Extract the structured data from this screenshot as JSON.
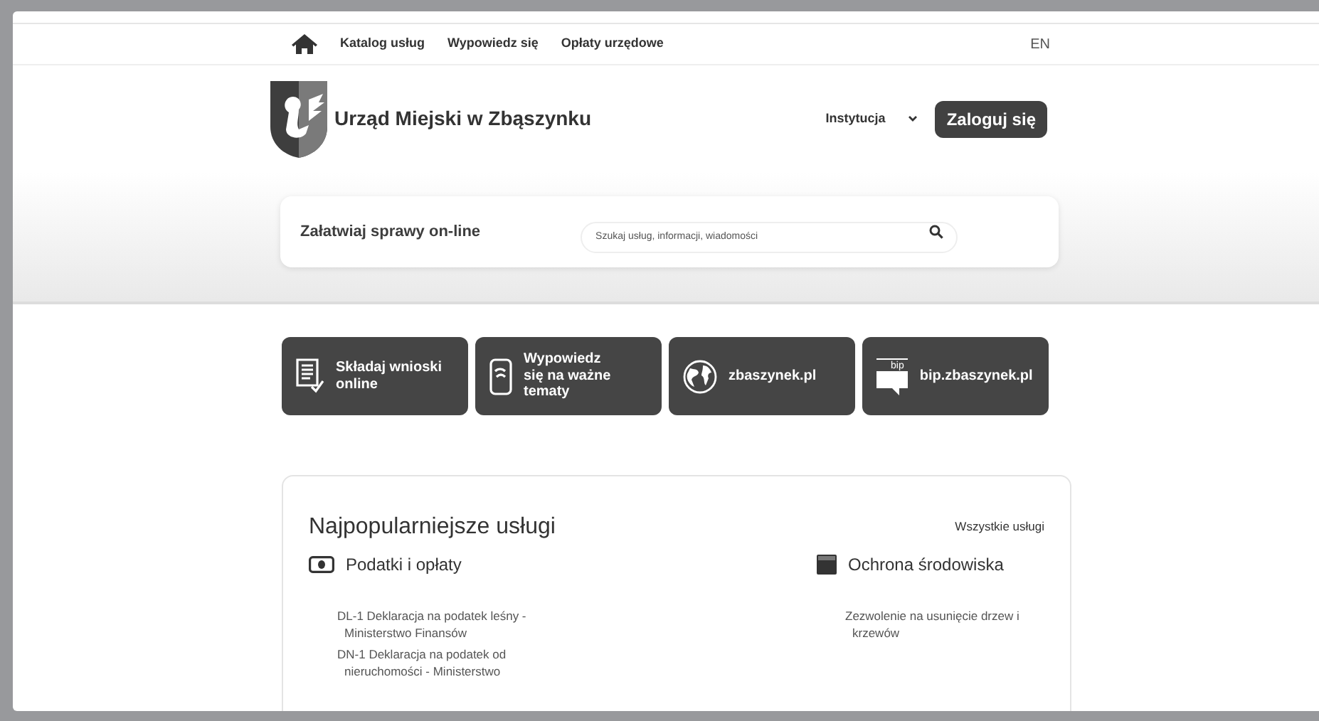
{
  "nav": {
    "links": [
      "Katalog usług",
      "Wypowiedz się",
      "Opłaty urzędowe"
    ],
    "language": "EN"
  },
  "header": {
    "title": "Urząd Miejski w Zbąszynku",
    "institution": "Instytucja",
    "login": "Zaloguj się"
  },
  "search": {
    "label": "Załatwiaj sprawy on-line",
    "placeholder": "Szukaj usług, informacji, wiadomości"
  },
  "tiles": [
    {
      "kind": "form",
      "label": "Składaj wnioski online"
    },
    {
      "kind": "phone",
      "label": "Wypowiedz się na ważne tematy"
    },
    {
      "kind": "globe",
      "label": "zbaszynek.pl"
    },
    {
      "kind": "bip",
      "label": "bip.zbaszynek.pl",
      "icon_text": "bip"
    }
  ],
  "popular": {
    "title": "Najpopularniejsze usługi",
    "all_link": "Wszystkie usługi",
    "categories": [
      {
        "kind": "money",
        "title": "Podatki i opłaty",
        "services": [
          "DL-1 Deklaracja na podatek leśny - Ministerstwo Finansów",
          "DN-1 Deklaracja na podatek od nieruchomości - Ministerstwo"
        ]
      },
      {
        "kind": "box",
        "title": "Ochrona środowiska",
        "services": [
          "Zezwolenie na usunięcie drzew i krzewów"
        ]
      }
    ]
  }
}
